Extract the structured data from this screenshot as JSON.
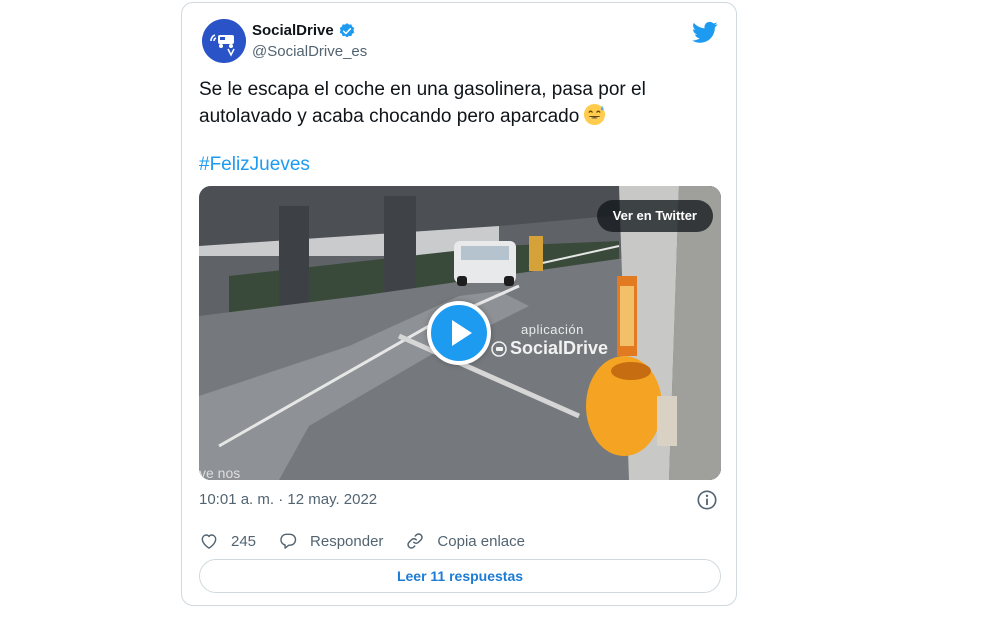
{
  "author": {
    "display_name": "SocialDrive",
    "handle": "@SocialDrive_es",
    "verified": true,
    "avatar_icon": "socialdrive-logo-icon"
  },
  "platform_icon": "twitter-bird-icon",
  "tweet": {
    "text": "Se le escapa el coche en una gasolinera, pasa por el\nautolavado y acaba chocando pero aparcado",
    "emoji": "sweat-smile-emoji",
    "hashtag": "#FelizJueves"
  },
  "media": {
    "watch_label": "Ver en Twitter",
    "watermark_small": "aplicación",
    "watermark_big": "SocialDrive",
    "play_icon": "play-icon"
  },
  "meta": {
    "timestamp": "10:01 a. m. · 12 may. 2022"
  },
  "actions": {
    "like_count": "245",
    "reply_label": "Responder",
    "copy_label": "Copia enlace"
  },
  "replies_button": "Leer 11 respuestas",
  "colors": {
    "accent": "#1d9bf0",
    "link": "#1d7bd4",
    "secondary_text": "#536471",
    "border": "#cfd9de"
  }
}
